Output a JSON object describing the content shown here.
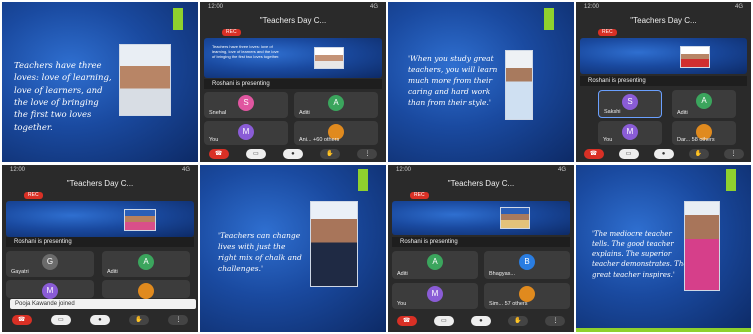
{
  "colors": {
    "slide_blue": "#1a4aa0",
    "accent_green": "#8fd12e",
    "end_call_red": "#d93025",
    "rec_red": "#d93025"
  },
  "slides": {
    "s1": "Teachers have three loves: love of learning, love of learners, and the love of bringing the first two loves together.",
    "s2": "'When you study great teachers, you will learn much more from their caring and hard work than from their style.'",
    "s3": "'Teachers can change lives with just the right mix of chalk and challenges.'",
    "s4": "'The mediocre teacher tells. The good teacher explains. The superior teacher demonstrates. The great teacher inspires.'"
  },
  "call": {
    "title": "\"Teachers Day C...",
    "rec_label": "REC",
    "presenting": "Roshani is presenting",
    "time": "12:00",
    "signal": "4G"
  },
  "phone1": {
    "participants": [
      {
        "initial": "S",
        "name": "Snehal",
        "color": "#e056a0"
      },
      {
        "initial": "A",
        "name": "Aditi",
        "color": "#3ba55d"
      },
      {
        "initial": "M",
        "name": "You",
        "color": "#8a5cd6"
      },
      {
        "initial": "",
        "name": "Ani... +60 others",
        "color": "#e08a1e"
      }
    ]
  },
  "phone2": {
    "participants": [
      {
        "initial": "S",
        "name": "Sakshi",
        "color": "#8a5cd6"
      },
      {
        "initial": "A",
        "name": "Aditi",
        "color": "#3ba55d"
      },
      {
        "initial": "M",
        "name": "You",
        "color": "#8a5cd6"
      },
      {
        "initial": "",
        "name": "Dar... 58 others",
        "color": "#e08a1e"
      }
    ]
  },
  "phone3": {
    "participants": [
      {
        "initial": "G",
        "name": "Gayatri",
        "color": "#6b6b6b"
      },
      {
        "initial": "A",
        "name": "Aditi",
        "color": "#3ba55d"
      },
      {
        "initial": "M",
        "name": "",
        "color": "#8a5cd6"
      },
      {
        "initial": "",
        "name": "",
        "color": "#e08a1e"
      }
    ],
    "toast": "Pooja Kawande joined"
  },
  "phone4": {
    "participants": [
      {
        "initial": "A",
        "name": "Aditi",
        "color": "#3ba55d"
      },
      {
        "initial": "B",
        "name": "Bhagyas...",
        "color": "#2a7de1"
      },
      {
        "initial": "M",
        "name": "You",
        "color": "#8a5cd6"
      },
      {
        "initial": "",
        "name": "Sim... 57 others",
        "color": "#e08a1e"
      }
    ]
  },
  "controls": [
    "end",
    "cam",
    "mic",
    "hand",
    "more"
  ]
}
